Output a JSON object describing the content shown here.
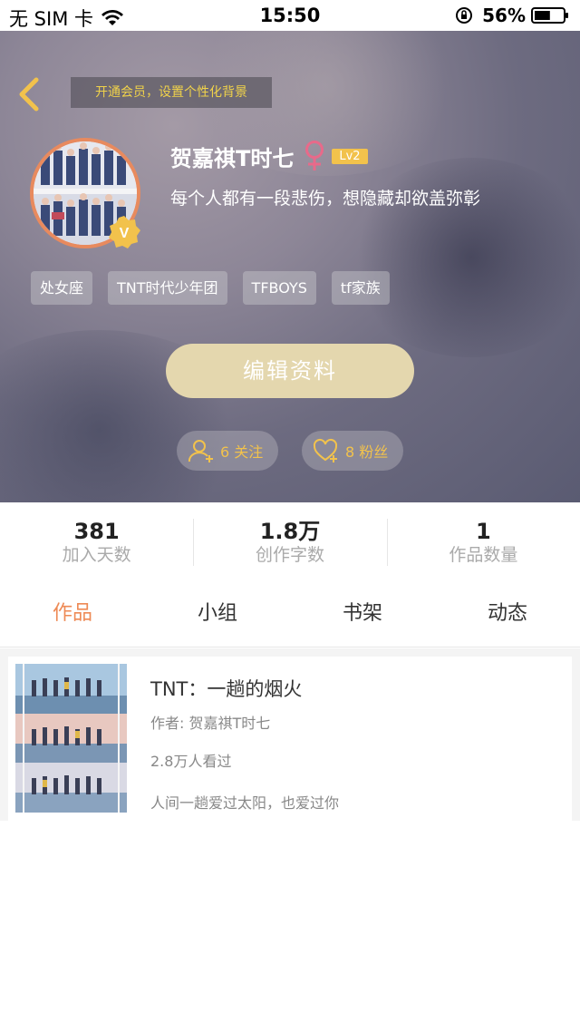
{
  "status_bar": {
    "carrier": "无 SIM 卡",
    "time": "15:50",
    "battery_percent": "56%",
    "battery_level": 0.56
  },
  "header": {
    "vip_banner": "开通会员，设置个性化背景",
    "username": "贺嘉祺T时七",
    "level": "Lv2",
    "bio": "每个人都有一段悲伤，想隐藏却欲盖弥彰",
    "tags": [
      "处女座",
      "TNT时代少年团",
      "TFBOYS",
      "tf家族"
    ],
    "edit_button": "编辑资料",
    "follow_label": "6 关注",
    "fans_label": "8 粉丝",
    "verified_badge": "V"
  },
  "stats": [
    {
      "value": "381",
      "label": "加入天数"
    },
    {
      "value": "1.8万",
      "label": "创作字数"
    },
    {
      "value": "1",
      "label": "作品数量"
    }
  ],
  "tabs": [
    {
      "label": "作品",
      "active": true
    },
    {
      "label": "小组",
      "active": false
    },
    {
      "label": "书架",
      "active": false
    },
    {
      "label": "动态",
      "active": false
    }
  ],
  "works": [
    {
      "title": "TNT：一趟的烟火",
      "author": "作者: 贺嘉祺T时七",
      "views": "2.8万人看过",
      "intro": "人间一趟爱过太阳，也爱过你"
    }
  ],
  "colors": {
    "accent": "#ee8a55",
    "gold": "#f2c24c",
    "edit_button": "#e4d7ae",
    "female_icon": "#e86a8a"
  }
}
